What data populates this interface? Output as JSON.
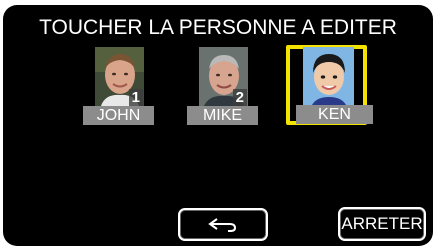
{
  "header": {
    "title": "TOUCHER LA PERSONNE A EDITER"
  },
  "people": [
    {
      "name": "JOHN",
      "number": "1",
      "selected": false
    },
    {
      "name": "MIKE",
      "number": "2",
      "selected": false
    },
    {
      "name": "KEN",
      "number": "",
      "selected": true
    }
  ],
  "footer": {
    "back_icon": "return-arrow-icon",
    "stop_label": "ARRETER"
  },
  "colors": {
    "background": "#000000",
    "selection": "#f4e300",
    "name_bar": "#8c8c8c",
    "text": "#ffffff"
  }
}
